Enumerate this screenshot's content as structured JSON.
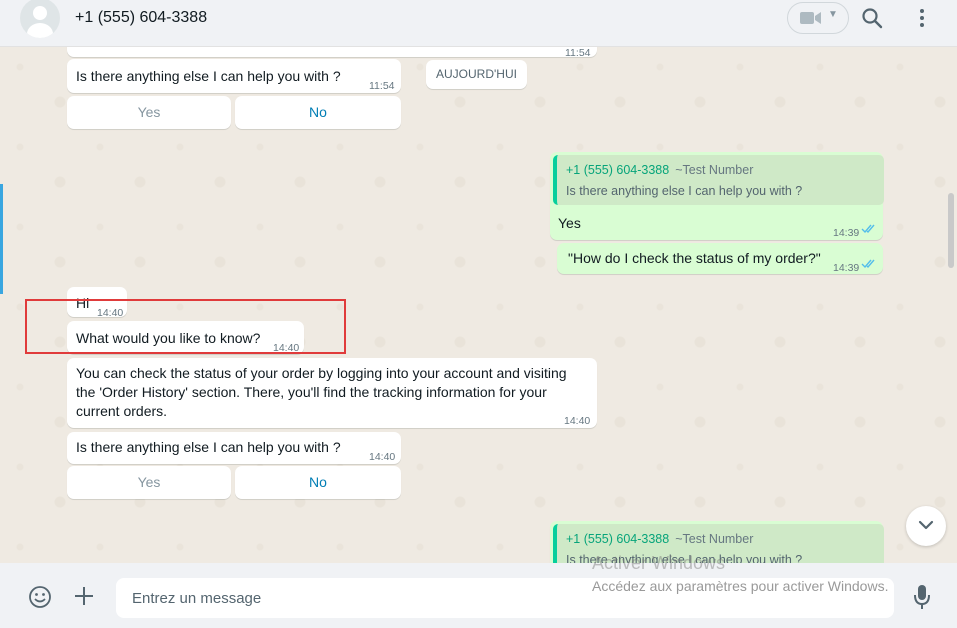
{
  "header": {
    "contact_name": "+1 (555) 604-3388"
  },
  "chat": {
    "top_partial_time": "11:54",
    "date_chip": "AUJOURD'HUI",
    "messages": [
      {
        "id": "m1",
        "direction": "in",
        "text": "Is there anything else I can help you with ?",
        "time": "11:54",
        "buttons": [
          "Yes",
          "No"
        ]
      },
      {
        "id": "m2",
        "direction": "out",
        "quote_sender": "+1 (555) 604-3388",
        "quote_name": "~Test Number",
        "quote_text": "Is there anything else I can help you with ?",
        "text": "Yes",
        "time": "14:39",
        "status": "read"
      },
      {
        "id": "m3",
        "direction": "out",
        "text": "\"How do I check the status of my order?\"",
        "time": "14:39",
        "status": "read"
      },
      {
        "id": "m4",
        "direction": "in",
        "text": "Hi",
        "time": "14:40"
      },
      {
        "id": "m5",
        "direction": "in",
        "text": "What would you like to know?",
        "time": "14:40"
      },
      {
        "id": "m6",
        "direction": "in",
        "lines": [
          "You can check the status of your order by logging into your account and visiting",
          "the 'Order History' section. There, you'll find the tracking information for your",
          "current orders."
        ],
        "time": "14:40"
      },
      {
        "id": "m7",
        "direction": "in",
        "text": "Is there anything else I can help you with ?",
        "time": "14:40",
        "buttons": [
          "Yes",
          "No"
        ]
      },
      {
        "id": "m8",
        "direction": "out",
        "quote_sender": "+1 (555) 604-3388",
        "quote_name": "~Test Number",
        "quote_text": "Is there anything else I can help you with ?"
      }
    ]
  },
  "footer": {
    "input_placeholder": "Entrez un message"
  },
  "watermark": {
    "title": "Activer Windows",
    "subtitle": "Accédez aux paramètres pour activer Windows."
  },
  "icons": [
    "video-call-icon",
    "chevron-down-icon",
    "search-icon",
    "menu-icon",
    "emoji-icon",
    "plus-icon",
    "mic-icon",
    "double-check-icon"
  ],
  "colors": {
    "incoming_bubble": "#ffffff",
    "outgoing_bubble": "#d9fdd3",
    "quote_accent": "#06cf9c",
    "read_ticks": "#53bdeb",
    "quick_reply_blue": "#027eb5",
    "highlight_box": "#e03b3b"
  }
}
